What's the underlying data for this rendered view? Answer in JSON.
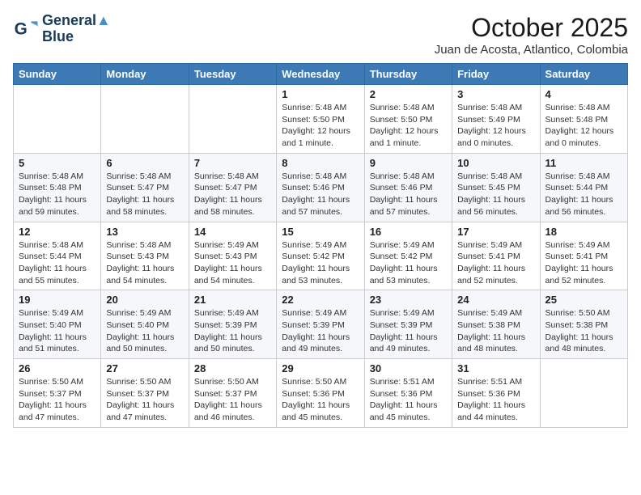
{
  "logo": {
    "line1": "General",
    "line2": "Blue"
  },
  "title": "October 2025",
  "subtitle": "Juan de Acosta, Atlantico, Colombia",
  "weekdays": [
    "Sunday",
    "Monday",
    "Tuesday",
    "Wednesday",
    "Thursday",
    "Friday",
    "Saturday"
  ],
  "weeks": [
    [
      {
        "day": "",
        "info": ""
      },
      {
        "day": "",
        "info": ""
      },
      {
        "day": "",
        "info": ""
      },
      {
        "day": "1",
        "info": "Sunrise: 5:48 AM\nSunset: 5:50 PM\nDaylight: 12 hours\nand 1 minute."
      },
      {
        "day": "2",
        "info": "Sunrise: 5:48 AM\nSunset: 5:50 PM\nDaylight: 12 hours\nand 1 minute."
      },
      {
        "day": "3",
        "info": "Sunrise: 5:48 AM\nSunset: 5:49 PM\nDaylight: 12 hours\nand 0 minutes."
      },
      {
        "day": "4",
        "info": "Sunrise: 5:48 AM\nSunset: 5:48 PM\nDaylight: 12 hours\nand 0 minutes."
      }
    ],
    [
      {
        "day": "5",
        "info": "Sunrise: 5:48 AM\nSunset: 5:48 PM\nDaylight: 11 hours\nand 59 minutes."
      },
      {
        "day": "6",
        "info": "Sunrise: 5:48 AM\nSunset: 5:47 PM\nDaylight: 11 hours\nand 58 minutes."
      },
      {
        "day": "7",
        "info": "Sunrise: 5:48 AM\nSunset: 5:47 PM\nDaylight: 11 hours\nand 58 minutes."
      },
      {
        "day": "8",
        "info": "Sunrise: 5:48 AM\nSunset: 5:46 PM\nDaylight: 11 hours\nand 57 minutes."
      },
      {
        "day": "9",
        "info": "Sunrise: 5:48 AM\nSunset: 5:46 PM\nDaylight: 11 hours\nand 57 minutes."
      },
      {
        "day": "10",
        "info": "Sunrise: 5:48 AM\nSunset: 5:45 PM\nDaylight: 11 hours\nand 56 minutes."
      },
      {
        "day": "11",
        "info": "Sunrise: 5:48 AM\nSunset: 5:44 PM\nDaylight: 11 hours\nand 56 minutes."
      }
    ],
    [
      {
        "day": "12",
        "info": "Sunrise: 5:48 AM\nSunset: 5:44 PM\nDaylight: 11 hours\nand 55 minutes."
      },
      {
        "day": "13",
        "info": "Sunrise: 5:48 AM\nSunset: 5:43 PM\nDaylight: 11 hours\nand 54 minutes."
      },
      {
        "day": "14",
        "info": "Sunrise: 5:49 AM\nSunset: 5:43 PM\nDaylight: 11 hours\nand 54 minutes."
      },
      {
        "day": "15",
        "info": "Sunrise: 5:49 AM\nSunset: 5:42 PM\nDaylight: 11 hours\nand 53 minutes."
      },
      {
        "day": "16",
        "info": "Sunrise: 5:49 AM\nSunset: 5:42 PM\nDaylight: 11 hours\nand 53 minutes."
      },
      {
        "day": "17",
        "info": "Sunrise: 5:49 AM\nSunset: 5:41 PM\nDaylight: 11 hours\nand 52 minutes."
      },
      {
        "day": "18",
        "info": "Sunrise: 5:49 AM\nSunset: 5:41 PM\nDaylight: 11 hours\nand 52 minutes."
      }
    ],
    [
      {
        "day": "19",
        "info": "Sunrise: 5:49 AM\nSunset: 5:40 PM\nDaylight: 11 hours\nand 51 minutes."
      },
      {
        "day": "20",
        "info": "Sunrise: 5:49 AM\nSunset: 5:40 PM\nDaylight: 11 hours\nand 50 minutes."
      },
      {
        "day": "21",
        "info": "Sunrise: 5:49 AM\nSunset: 5:39 PM\nDaylight: 11 hours\nand 50 minutes."
      },
      {
        "day": "22",
        "info": "Sunrise: 5:49 AM\nSunset: 5:39 PM\nDaylight: 11 hours\nand 49 minutes."
      },
      {
        "day": "23",
        "info": "Sunrise: 5:49 AM\nSunset: 5:39 PM\nDaylight: 11 hours\nand 49 minutes."
      },
      {
        "day": "24",
        "info": "Sunrise: 5:49 AM\nSunset: 5:38 PM\nDaylight: 11 hours\nand 48 minutes."
      },
      {
        "day": "25",
        "info": "Sunrise: 5:50 AM\nSunset: 5:38 PM\nDaylight: 11 hours\nand 48 minutes."
      }
    ],
    [
      {
        "day": "26",
        "info": "Sunrise: 5:50 AM\nSunset: 5:37 PM\nDaylight: 11 hours\nand 47 minutes."
      },
      {
        "day": "27",
        "info": "Sunrise: 5:50 AM\nSunset: 5:37 PM\nDaylight: 11 hours\nand 47 minutes."
      },
      {
        "day": "28",
        "info": "Sunrise: 5:50 AM\nSunset: 5:37 PM\nDaylight: 11 hours\nand 46 minutes."
      },
      {
        "day": "29",
        "info": "Sunrise: 5:50 AM\nSunset: 5:36 PM\nDaylight: 11 hours\nand 45 minutes."
      },
      {
        "day": "30",
        "info": "Sunrise: 5:51 AM\nSunset: 5:36 PM\nDaylight: 11 hours\nand 45 minutes."
      },
      {
        "day": "31",
        "info": "Sunrise: 5:51 AM\nSunset: 5:36 PM\nDaylight: 11 hours\nand 44 minutes."
      },
      {
        "day": "",
        "info": ""
      }
    ]
  ]
}
